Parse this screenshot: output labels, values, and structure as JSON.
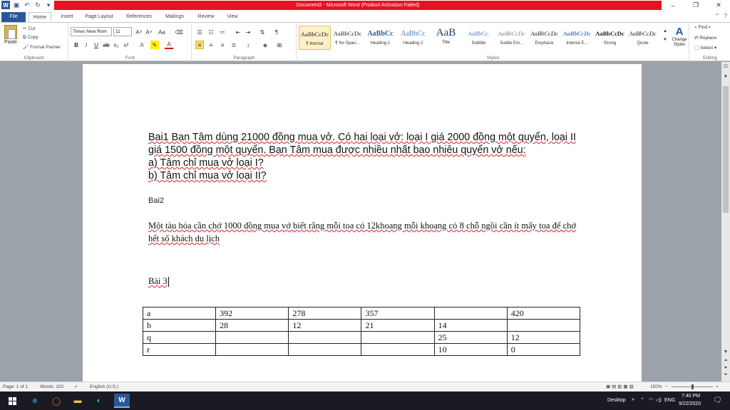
{
  "app": {
    "title": "Document2 - Microsoft Word (Product Activation Failed)",
    "icon_letter": "W",
    "accent": "#2b579a",
    "alert_color": "#e81123"
  },
  "qat": {
    "icons": [
      "word-icon",
      "save-icon",
      "undo-icon",
      "redo-icon",
      "customize-icon"
    ]
  },
  "window_controls": {
    "minimize": "–",
    "restore": "❐",
    "close": "✕"
  },
  "tabs": [
    {
      "label": "File",
      "active": false
    },
    {
      "label": "Home",
      "active": true
    },
    {
      "label": "Insert",
      "active": false
    },
    {
      "label": "Page Layout",
      "active": false
    },
    {
      "label": "References",
      "active": false
    },
    {
      "label": "Mailings",
      "active": false
    },
    {
      "label": "Review",
      "active": false
    },
    {
      "label": "View",
      "active": false
    }
  ],
  "ribbon": {
    "clipboard": {
      "paste": "Paste",
      "cut": "Cut",
      "copy": "Copy",
      "format_painter": "Format Painter",
      "label": "Clipboard"
    },
    "font": {
      "name": "Times New Rom",
      "size": "11",
      "label": "Font"
    },
    "paragraph": {
      "label": "Paragraph"
    },
    "styles": {
      "label": "Styles",
      "items": [
        {
          "preview": "AaBbCcDc",
          "name": "¶ Normal",
          "active": true
        },
        {
          "preview": "AaBbCcDc",
          "name": "¶ No Spaci...",
          "active": false
        },
        {
          "preview": "AaBbCc",
          "name": "Heading 1",
          "active": false
        },
        {
          "preview": "AaBbCc",
          "name": "Heading 2",
          "active": false
        },
        {
          "preview": "AaB",
          "name": "Title",
          "active": false
        },
        {
          "preview": "AaBbCc.",
          "name": "Subtitle",
          "active": false
        },
        {
          "preview": "AaBbCcDc",
          "name": "Subtle Em...",
          "active": false
        },
        {
          "preview": "AaBbCcDc",
          "name": "Emphasis",
          "active": false
        },
        {
          "preview": "AaBbCcDc",
          "name": "Intense E...",
          "active": false
        },
        {
          "preview": "AaBbCcDc",
          "name": "Strong",
          "active": false
        },
        {
          "preview": "AaBbCcDc",
          "name": "Quote",
          "active": false
        }
      ],
      "change_styles": "Change Styles"
    },
    "editing": {
      "find": "Find",
      "replace": "Replace",
      "select": "Select",
      "label": "Editing"
    }
  },
  "document": {
    "para1": [
      "Bai1 Bạn Tâm dùng 21000 đồng mua vở. Có hai loại vở: loại I giá 2000 đồng một quyển, loại II giá 1500 đồng một quyển. Bạn Tâm mua được nhiều nhất bao nhiêu quyển vở nếu:",
      "a) Tâm chỉ mua vở loại I?",
      "b) Tâm chỉ mua vở loại II?"
    ],
    "bai2_heading": "Bai2",
    "para2": "Một tàu hỏa cần chở  1000 đồng mua vở  biết rằng mỗi toa   có 12khoang mỗi khoang cỏ 8 chỗ ngồi cần ít mấy toa để chở hết số khách du lịch",
    "bai3_heading": "Bài 3",
    "table": [
      [
        "a",
        "392",
        "278",
        "357",
        "",
        "420"
      ],
      [
        "b",
        "28",
        "12",
        "21",
        "14",
        ""
      ],
      [
        "q",
        "",
        "",
        "",
        "25",
        "12"
      ],
      [
        "r",
        "",
        "",
        "",
        "10",
        "0"
      ]
    ]
  },
  "status": {
    "page": "Page: 1 of 1",
    "words": "Words: 102",
    "language": "English (U.S.)",
    "zoom": "150%",
    "zoom_fraction": 0.5
  },
  "taskbar": {
    "desktop": "Desktop",
    "language": "ENG",
    "time": "7:40 PM",
    "date": "9/22/2020"
  }
}
